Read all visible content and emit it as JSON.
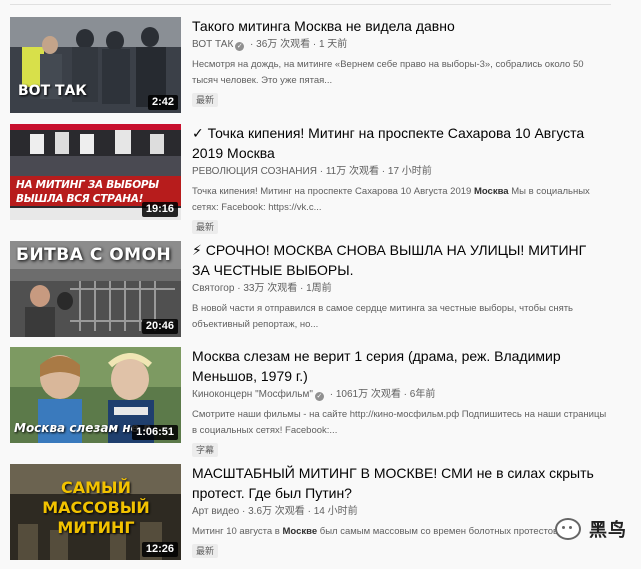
{
  "videos": [
    {
      "title": "Такого митинга Москва не видела давно",
      "channel": "ВОТ ТАК",
      "verified": true,
      "views": "36万 次观看",
      "age": "1 天前",
      "desc": "Несмотря на дождь, на митинге «Вернем себе право на выборы-3», собрались около 50 тысяч человек. Это уже пятая...",
      "desc_bold": "",
      "badge": "最新",
      "duration": "2:42",
      "thumb_text": "ВОТ ТАК"
    },
    {
      "title": "✓ Точка кипения! Митинг на проспекте Сахарова 10 Августа 2019 Москва",
      "channel": "РЕВОЛЮЦИЯ СОЗНАНИЯ",
      "verified": false,
      "views": "11万 次观看",
      "age": "17 小时前",
      "desc_pre": "Точка кипения! Митинг на проспекте Сахарова 10 Августа 2019 ",
      "desc_bold": "Москва",
      "desc_post": " Мы в социальных сетях: Facebook: https://vk.c...",
      "badge": "最新",
      "duration": "19:16",
      "thumb_text": "НА МИТИНГ ЗА ВЫБОРЫ ВЫШЛА ВСЯ СТРАНА!"
    },
    {
      "title": "⚡ СРОЧНО! МОСКВА СНОВА ВЫШЛА НА УЛИЦЫ! МИТИНГ ЗА ЧЕСТНЫЕ ВЫБОРЫ.",
      "channel": "Святогор",
      "verified": false,
      "views": "33万 次观看",
      "age": "1周前",
      "desc": "В новой части я отправился в самое сердце митинга за честные выборы, чтобы снять объективный репортаж, но...",
      "badge": "",
      "duration": "20:46",
      "thumb_text": "БИТВА С ОМОН"
    },
    {
      "title": "Москва слезам не верит 1 серия (драма, реж. Владимир Меньшов, 1979 г.)",
      "channel": "Киноконцерн \"Мосфильм\"",
      "verified": true,
      "views": "1061万 次观看",
      "age": "6年前",
      "desc": "Смотрите наши фильмы - на сайте http://кино-мосфильм.рф Подпишитесь на наши страницы в социальных сетях! Facebook:...",
      "badge": "字幕",
      "duration": "1:06:51",
      "thumb_text": "Москва слезам не в"
    },
    {
      "title": "МАСШТАБНЫЙ МИТИНГ В МОСКВЕ! СМИ не в силах скрыть протест. Где был Путин?",
      "channel": "Арт видео",
      "verified": false,
      "views": "3.6万 次观看",
      "age": "14 小时前",
      "desc_pre": "Митинг 10 августа в ",
      "desc_bold": "Москве",
      "desc_post": " был самым массовым со времен болотных протестов.",
      "badge": "最新",
      "duration": "12:26",
      "thumb_text": "САМЫЙ МАССОВЫЙ МИТИНГ"
    }
  ],
  "watermark": "黑鸟"
}
